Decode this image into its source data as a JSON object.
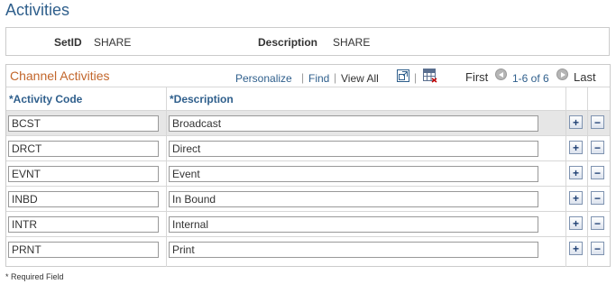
{
  "page": {
    "title": "Activities"
  },
  "header": {
    "setid_label": "SetID",
    "setid_value": "SHARE",
    "description_label": "Description",
    "description_value": "SHARE"
  },
  "grid": {
    "title": "Channel Activities",
    "nav": {
      "personalize": "Personalize",
      "sep1": "|",
      "find": "Find",
      "sep2": "|",
      "view_all": "View All",
      "sep3": "|",
      "first": "First",
      "range": "1-6 of 6",
      "last": "Last"
    },
    "columns": {
      "code": "*Activity Code",
      "description": "*Description"
    },
    "rows": [
      {
        "code": "BCST",
        "description": "Broadcast"
      },
      {
        "code": "DRCT",
        "description": "Direct"
      },
      {
        "code": "EVNT",
        "description": "Event"
      },
      {
        "code": "INBD",
        "description": "In Bound"
      },
      {
        "code": "INTR",
        "description": "Internal"
      },
      {
        "code": "PRNT",
        "description": "Print"
      }
    ],
    "add_label": "+",
    "delete_label": "−"
  },
  "footer": {
    "required_note": "* Required Field"
  },
  "colors": {
    "title": "#2f5f8c",
    "grid_title": "#c2662b",
    "selected_row": "#e6e6e6"
  },
  "icons": [
    "zoom-icon",
    "download-grid-icon",
    "previous-arrow-icon",
    "next-arrow-icon",
    "add-row-icon",
    "delete-row-icon"
  ]
}
